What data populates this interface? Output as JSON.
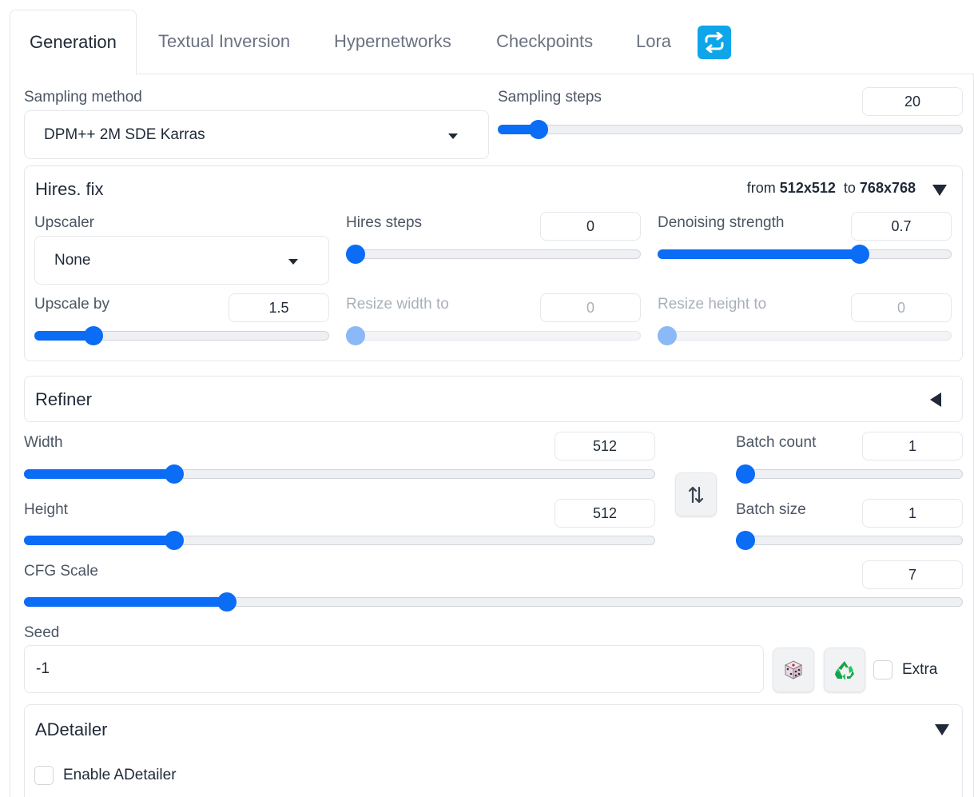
{
  "tabs": [
    {
      "label": "Generation",
      "active": true
    },
    {
      "label": "Textual Inversion",
      "active": false
    },
    {
      "label": "Hypernetworks",
      "active": false
    },
    {
      "label": "Checkpoints",
      "active": false
    },
    {
      "label": "Lora",
      "active": false
    }
  ],
  "refresh_icon": "refresh-icon",
  "accent_color": "#0b6cf5",
  "sampling": {
    "method_label": "Sampling method",
    "method_value": "DPM++ 2M SDE Karras",
    "steps_label": "Sampling steps",
    "steps_value": "20"
  },
  "hires": {
    "title": "Hires. fix",
    "summary_from": "from",
    "summary_from_value": "512x512",
    "summary_to": "to",
    "summary_to_value": "768x768",
    "upscaler_label": "Upscaler",
    "upscaler_value": "None",
    "steps_label": "Hires steps",
    "steps_value": "0",
    "denoise_label": "Denoising strength",
    "denoise_value": "0.7",
    "upscale_by_label": "Upscale by",
    "upscale_by_value": "1.5",
    "resize_w_label": "Resize width to",
    "resize_w_value": "0",
    "resize_h_label": "Resize height to",
    "resize_h_value": "0"
  },
  "refiner": {
    "title": "Refiner"
  },
  "dims": {
    "width_label": "Width",
    "width_value": "512",
    "height_label": "Height",
    "height_value": "512",
    "swap_icon": "swap-arrows-icon"
  },
  "batch": {
    "count_label": "Batch count",
    "count_value": "1",
    "size_label": "Batch size",
    "size_value": "1"
  },
  "cfg": {
    "label": "CFG Scale",
    "value": "7"
  },
  "seed": {
    "label": "Seed",
    "value": "-1",
    "random_icon": "dice-icon",
    "reuse_icon": "recycle-icon",
    "extra_label": "Extra"
  },
  "adetailer": {
    "title": "ADetailer",
    "enable_label": "Enable ADetailer"
  },
  "slider_levels": {
    "sampling_steps": 0.07,
    "hires_steps": 0.0,
    "denoise": 0.7,
    "upscale_by": 0.18,
    "resize_w": 0.0,
    "resize_h": 0.0,
    "width": 0.23,
    "height": 0.23,
    "batch_count": 0.0,
    "batch_size": 0.0,
    "cfg": 0.21
  }
}
